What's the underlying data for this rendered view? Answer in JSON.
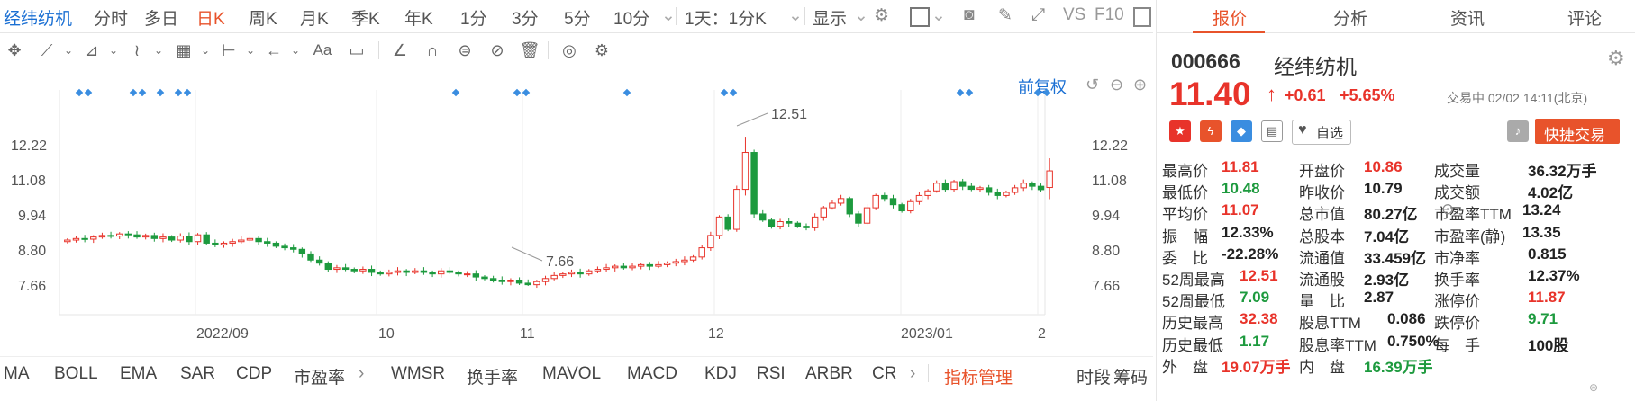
{
  "topbar": {
    "stock_name": "经纬纺机",
    "tabs": [
      "分时",
      "多日",
      "日K",
      "周K",
      "月K",
      "季K",
      "年K",
      "1分",
      "3分",
      "5分",
      "10分"
    ],
    "interval_select": "1天：1分K",
    "display_select": "显示",
    "vs_label": "VS",
    "f10_label": "F10"
  },
  "chart": {
    "restore_label": "前复权",
    "x_labels": [
      "2022/09",
      "10",
      "11",
      "12",
      "2023/01",
      "2"
    ],
    "y_ticks": [
      "12.22",
      "11.08",
      "9.94",
      "8.80",
      "7.66"
    ],
    "annot_high": "12.51",
    "annot_low": "7.66"
  },
  "chart_data": {
    "type": "candlestick",
    "y_ticks": [
      12.22,
      11.08,
      9.94,
      8.8,
      7.66
    ],
    "ylim": [
      6.6,
      13.3
    ],
    "max_annotation": 12.51,
    "min_annotation": 7.66,
    "closes": [
      9.15,
      9.2,
      9.18,
      9.25,
      9.3,
      9.28,
      9.35,
      9.32,
      9.25,
      9.3,
      9.2,
      9.25,
      9.15,
      9.28,
      9.1,
      9.32,
      9.05,
      9.0,
      9.05,
      9.1,
      9.15,
      9.2,
      9.1,
      9.05,
      8.95,
      8.9,
      8.85,
      8.7,
      8.5,
      8.4,
      8.2,
      8.25,
      8.2,
      8.15,
      8.2,
      8.1,
      8.05,
      8.1,
      8.15,
      8.1,
      8.15,
      8.1,
      8.05,
      8.15,
      8.1,
      8.05,
      8.05,
      7.95,
      7.9,
      7.85,
      7.8,
      7.85,
      7.75,
      7.7,
      7.8,
      7.9,
      8.0,
      8.05,
      8.1,
      8.05,
      8.15,
      8.2,
      8.25,
      8.3,
      8.25,
      8.3,
      8.35,
      8.3,
      8.35,
      8.4,
      8.45,
      8.5,
      8.6,
      8.9,
      9.3,
      9.9,
      9.5,
      10.8,
      12.0,
      10.0,
      9.8,
      9.6,
      9.75,
      9.7,
      9.6,
      9.55,
      9.9,
      10.2,
      10.35,
      10.5,
      10.0,
      9.7,
      10.2,
      10.6,
      10.5,
      10.3,
      10.1,
      10.4,
      10.6,
      10.75,
      11.0,
      10.8,
      11.05,
      10.9,
      10.8,
      10.85,
      10.7,
      10.6,
      10.7,
      10.85,
      11.0,
      10.9,
      10.79,
      11.4
    ],
    "last": {
      "open": 10.86,
      "high": 11.81,
      "low": 10.48,
      "close": 11.4
    }
  },
  "indicators": {
    "items": [
      "MA",
      "BOLL",
      "EMA",
      "SAR",
      "CDP",
      "市盈率",
      "WMSR",
      "换手率",
      "MAVOL",
      "MACD",
      "KDJ",
      "RSI",
      "ARBR",
      "CR"
    ],
    "manage_label": "指标管理",
    "right_items": [
      "时段",
      "筹码"
    ]
  },
  "panel": {
    "tabs": [
      "报价",
      "分析",
      "资讯",
      "评论"
    ],
    "code": "000666",
    "name": "经纬纺机",
    "price": "11.40",
    "change": "+0.61",
    "change_pct": "+5.65%",
    "status": "交易中 02/02 14:11(北京)",
    "watch_label": "自选",
    "quick_trade": "快捷交易",
    "colors": {
      "up": "#e8332a",
      "down": "#1d9a3e",
      "accent": "#e8532b"
    },
    "stats": [
      [
        {
          "k": "最高价",
          "v": "11.81",
          "c": "red"
        },
        {
          "k": "开盘价",
          "v": "10.86",
          "c": "red"
        },
        {
          "k": "成交量",
          "v": "36.32万手",
          "c": "blk"
        }
      ],
      [
        {
          "k": "最低价",
          "v": "10.48",
          "c": "green"
        },
        {
          "k": "昨收价",
          "v": "10.79",
          "c": "blk"
        },
        {
          "k": "成交额",
          "v": "4.02亿",
          "c": "blk"
        }
      ],
      [
        {
          "k": "平均价",
          "v": "11.07",
          "c": "red"
        },
        {
          "k": "总市值",
          "v": "80.27亿",
          "c": "blk"
        },
        {
          "k": "市盈率TTM",
          "v": "13.24",
          "c": "blk"
        }
      ],
      [
        {
          "k": "振　幅",
          "v": "12.33%",
          "c": "blk"
        },
        {
          "k": "总股本",
          "v": "7.04亿",
          "c": "blk"
        },
        {
          "k": "市盈率(静)",
          "v": "13.35",
          "c": "blk"
        }
      ],
      [
        {
          "k": "委　比",
          "v": "-22.28%",
          "c": "blk"
        },
        {
          "k": "流通值",
          "v": "33.459亿",
          "c": "blk"
        },
        {
          "k": "市净率",
          "v": "0.815",
          "c": "blk"
        }
      ],
      [
        {
          "k": "52周最高",
          "v": "12.51",
          "c": "red"
        },
        {
          "k": "流通股",
          "v": "2.93亿",
          "c": "blk"
        },
        {
          "k": "换手率",
          "v": "12.37%",
          "c": "blk"
        }
      ],
      [
        {
          "k": "52周最低",
          "v": "7.09",
          "c": "green"
        },
        {
          "k": "量　比",
          "v": "2.87",
          "c": "blk"
        },
        {
          "k": "涨停价",
          "v": "11.87",
          "c": "red"
        }
      ],
      [
        {
          "k": "历史最高",
          "v": "32.38",
          "c": "red"
        },
        {
          "k": "股息TTM",
          "v": "0.086",
          "c": "blk"
        },
        {
          "k": "跌停价",
          "v": "9.71",
          "c": "green"
        }
      ],
      [
        {
          "k": "历史最低",
          "v": "1.17",
          "c": "green"
        },
        {
          "k": "股息率TTM",
          "v": "0.750%",
          "c": "blk"
        },
        {
          "k": "每　手",
          "v": "100股",
          "c": "blk"
        }
      ],
      [
        {
          "k": "外　盘",
          "v": "19.07万手",
          "c": "red"
        },
        {
          "k": "内　盘",
          "v": "16.39万手",
          "c": "green"
        },
        {
          "k": "",
          "v": "",
          "c": "blk"
        }
      ]
    ]
  }
}
